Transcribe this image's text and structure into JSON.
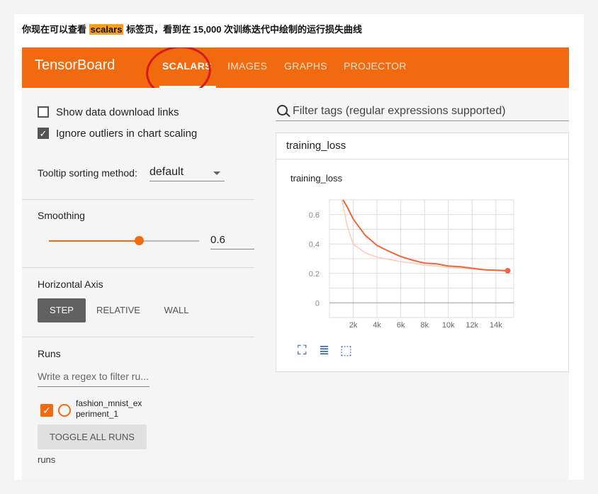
{
  "caption": {
    "before": "你现在可以查看 ",
    "highlight": "scalars",
    "after": " 标签页，看到在 15,000 次训练迭代中绘制的运行损失曲线"
  },
  "header": {
    "brand": "TensorBoard",
    "tabs": [
      "SCALARS",
      "IMAGES",
      "GRAPHS",
      "PROJECTOR"
    ],
    "accent": "#f26a10"
  },
  "sidebar": {
    "show_download": "Show data download links",
    "ignore_outliers": "Ignore outliers in chart scaling",
    "tooltip_label": "Tooltip sorting method:",
    "tooltip_value": "default",
    "smoothing_label": "Smoothing",
    "smoothing_value": "0.6",
    "smoothing_level": 0.6,
    "horizontal_axis_label": "Horizontal Axis",
    "axis_options": [
      "STEP",
      "RELATIVE",
      "WALL"
    ],
    "runs_label": "Runs",
    "regex_placeholder": "Write a regex to filter ru...",
    "run_name": "fashion_mnist_ex periment_1",
    "toggle_label": "TOGGLE ALL RUNS",
    "runs_footer": "runs"
  },
  "main": {
    "filter_placeholder": "Filter tags (regular expressions supported)",
    "panel_title": "training_loss"
  },
  "chart_data": {
    "type": "line",
    "title": "training_loss",
    "xlabel": "",
    "ylabel": "",
    "x_ticks": [
      "2k",
      "4k",
      "6k",
      "8k",
      "10k",
      "12k",
      "14k"
    ],
    "y_ticks": [
      "0",
      "0.2",
      "0.4",
      "0.6"
    ],
    "xlim": [
      0,
      15500
    ],
    "ylim": [
      -0.1,
      0.7
    ],
    "grid": true,
    "series": [
      {
        "color": "#fbcab9",
        "x": [
          1000,
          1500,
          2000,
          3000,
          4000,
          5000,
          6000,
          7000,
          8000,
          9000,
          10000,
          11000,
          12000,
          13000,
          14000,
          15000
        ],
        "y": [
          0.72,
          0.52,
          0.4,
          0.34,
          0.31,
          0.295,
          0.28,
          0.27,
          0.255,
          0.25,
          0.24,
          0.235,
          0.23,
          0.225,
          0.22,
          0.215
        ]
      },
      {
        "color": "#f2653a",
        "x": [
          1000,
          1500,
          2000,
          3000,
          4000,
          5000,
          6000,
          7000,
          8000,
          9000,
          10000,
          11000,
          12000,
          13000,
          14000,
          15000
        ],
        "y": [
          0.72,
          0.65,
          0.57,
          0.46,
          0.39,
          0.35,
          0.315,
          0.29,
          0.27,
          0.265,
          0.25,
          0.245,
          0.235,
          0.225,
          0.222,
          0.218
        ]
      }
    ]
  }
}
